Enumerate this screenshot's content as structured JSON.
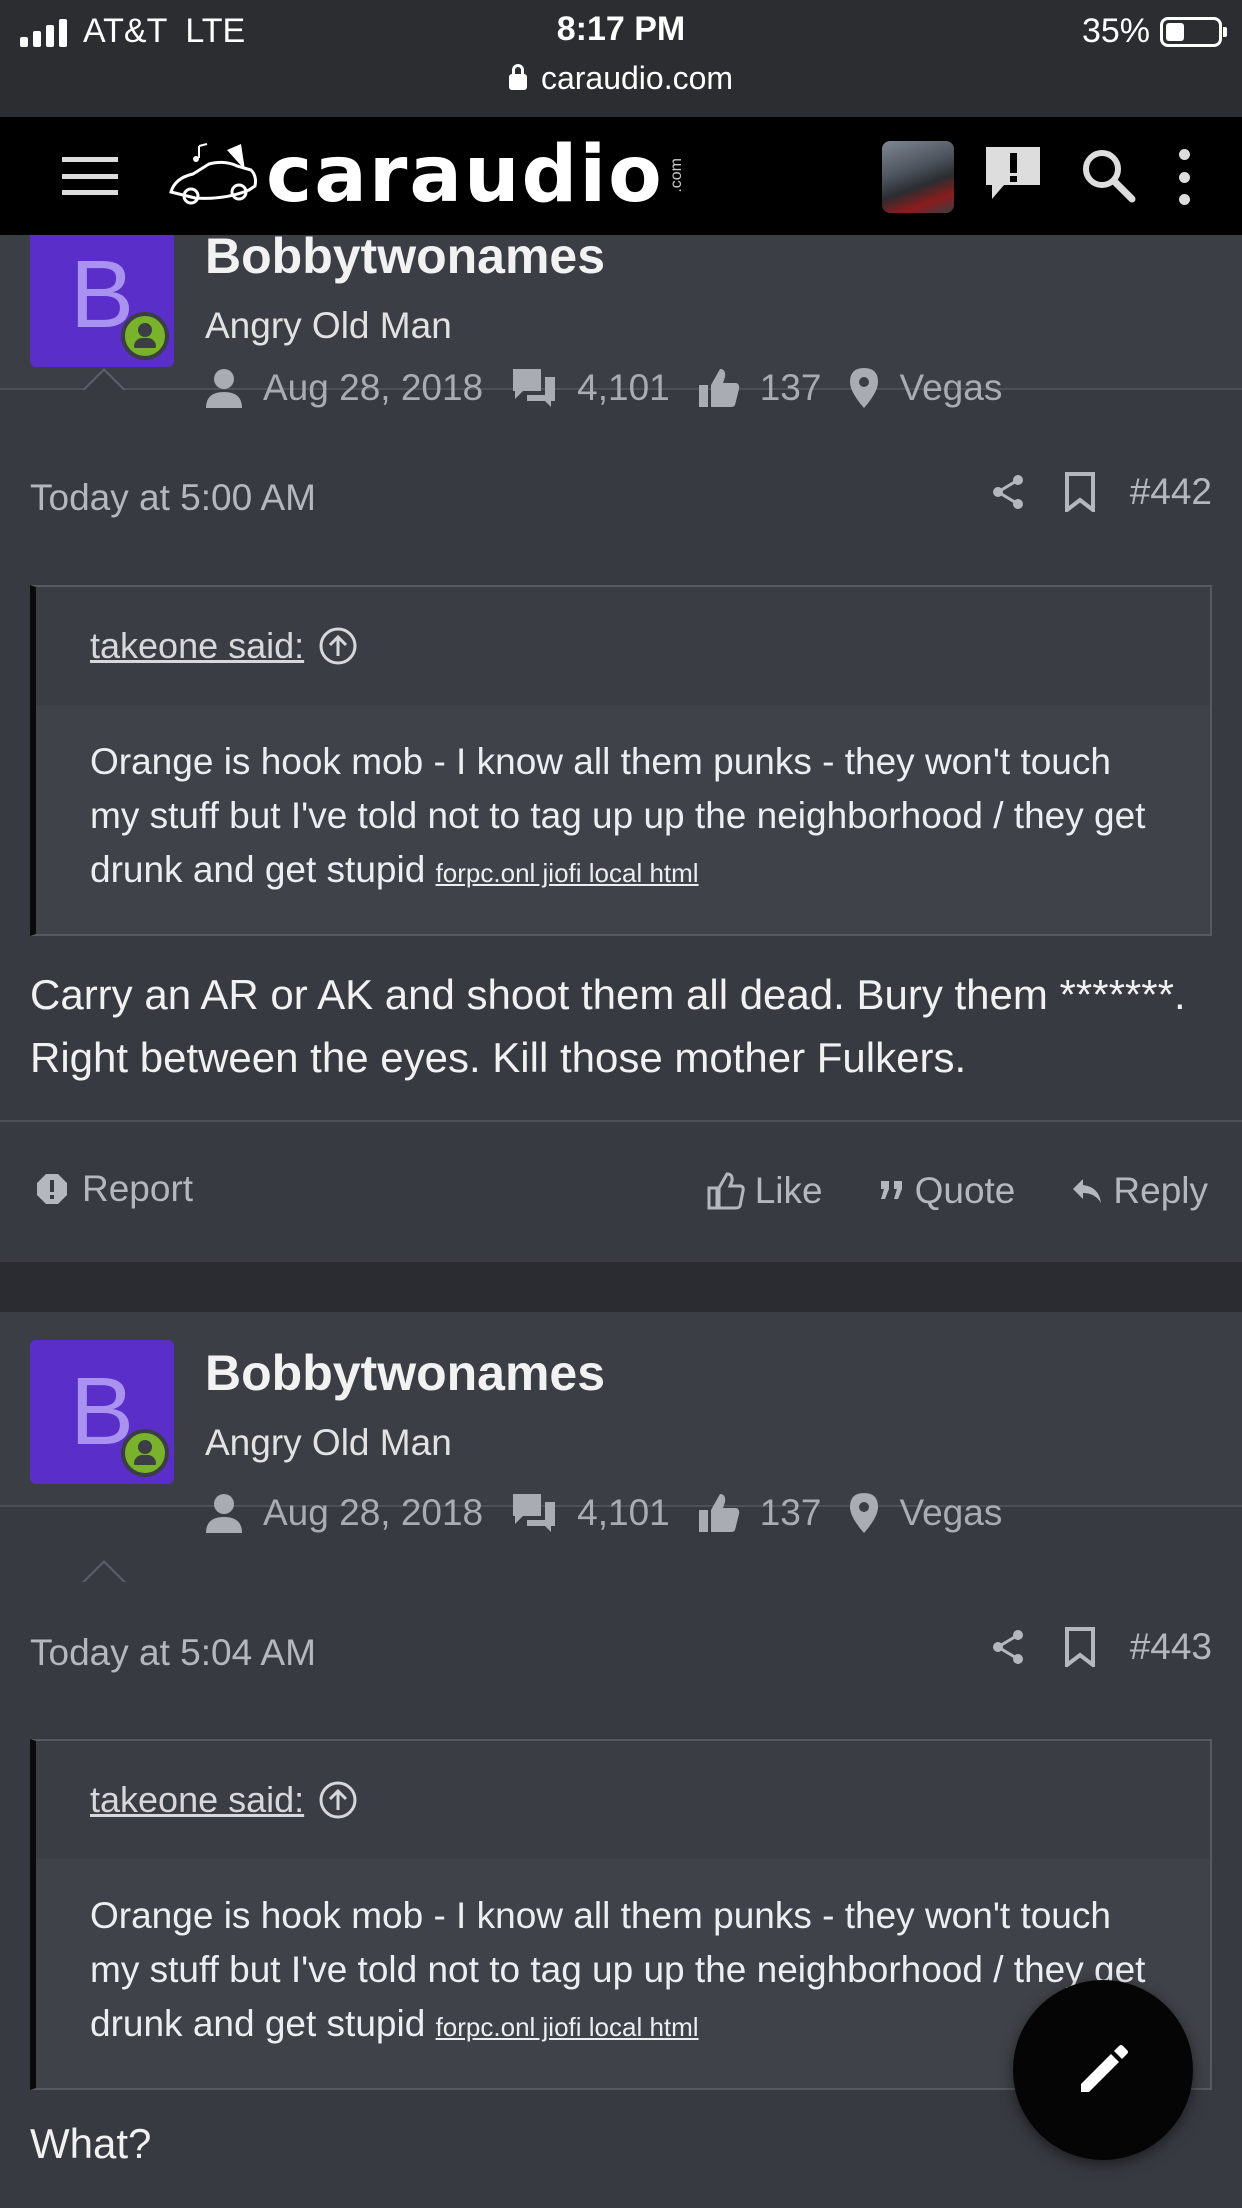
{
  "status_bar": {
    "carrier": "AT&T",
    "network": "LTE",
    "time": "8:17 PM",
    "url": "caraudio.com",
    "battery": "35%"
  },
  "header": {
    "logo_text": "caraudio",
    "logo_suffix": ".com"
  },
  "posts": [
    {
      "username": "Bobbytwonames",
      "user_title": "Angry Old Man",
      "avatar_letter": "B",
      "joined": "Aug 28, 2018",
      "messages": "4,101",
      "reactions": "137",
      "location": "Vegas",
      "date": "Today at 5:00 AM",
      "number": "#442",
      "quote_author": "takeone said:",
      "quote_text": "Orange is hook mob - I know all them punks - they won't touch my stuff but I've told not to tag up up the neighborhood / they get drunk and get stupid",
      "quote_links": "forpc.onl jiofi local html",
      "body": "Carry an AR or AK and shoot them all dead. Bury them *******. Right between the eyes. Kill those mother Fulkers.",
      "report_label": "Report",
      "like_label": "Like",
      "quote_label": "Quote",
      "reply_label": "Reply"
    },
    {
      "username": "Bobbytwonames",
      "user_title": "Angry Old Man",
      "avatar_letter": "B",
      "joined": "Aug 28, 2018",
      "messages": "4,101",
      "reactions": "137",
      "location": "Vegas",
      "date": "Today at 5:04 AM",
      "number": "#443",
      "quote_author": "takeone said:",
      "quote_text": "Orange is hook mob - I know all them punks - they won't touch my stuff but I've told not to tag up up the neighborhood / they get drunk and get stupid",
      "quote_links": "forpc.onl jiofi local html",
      "body": "What?"
    }
  ],
  "colors": {
    "page_bg": "#2d3035",
    "post_bg": "#373a40",
    "avatar_bg": "#5a2ec8",
    "online": "#79b32b",
    "header_bg": "#000000"
  }
}
